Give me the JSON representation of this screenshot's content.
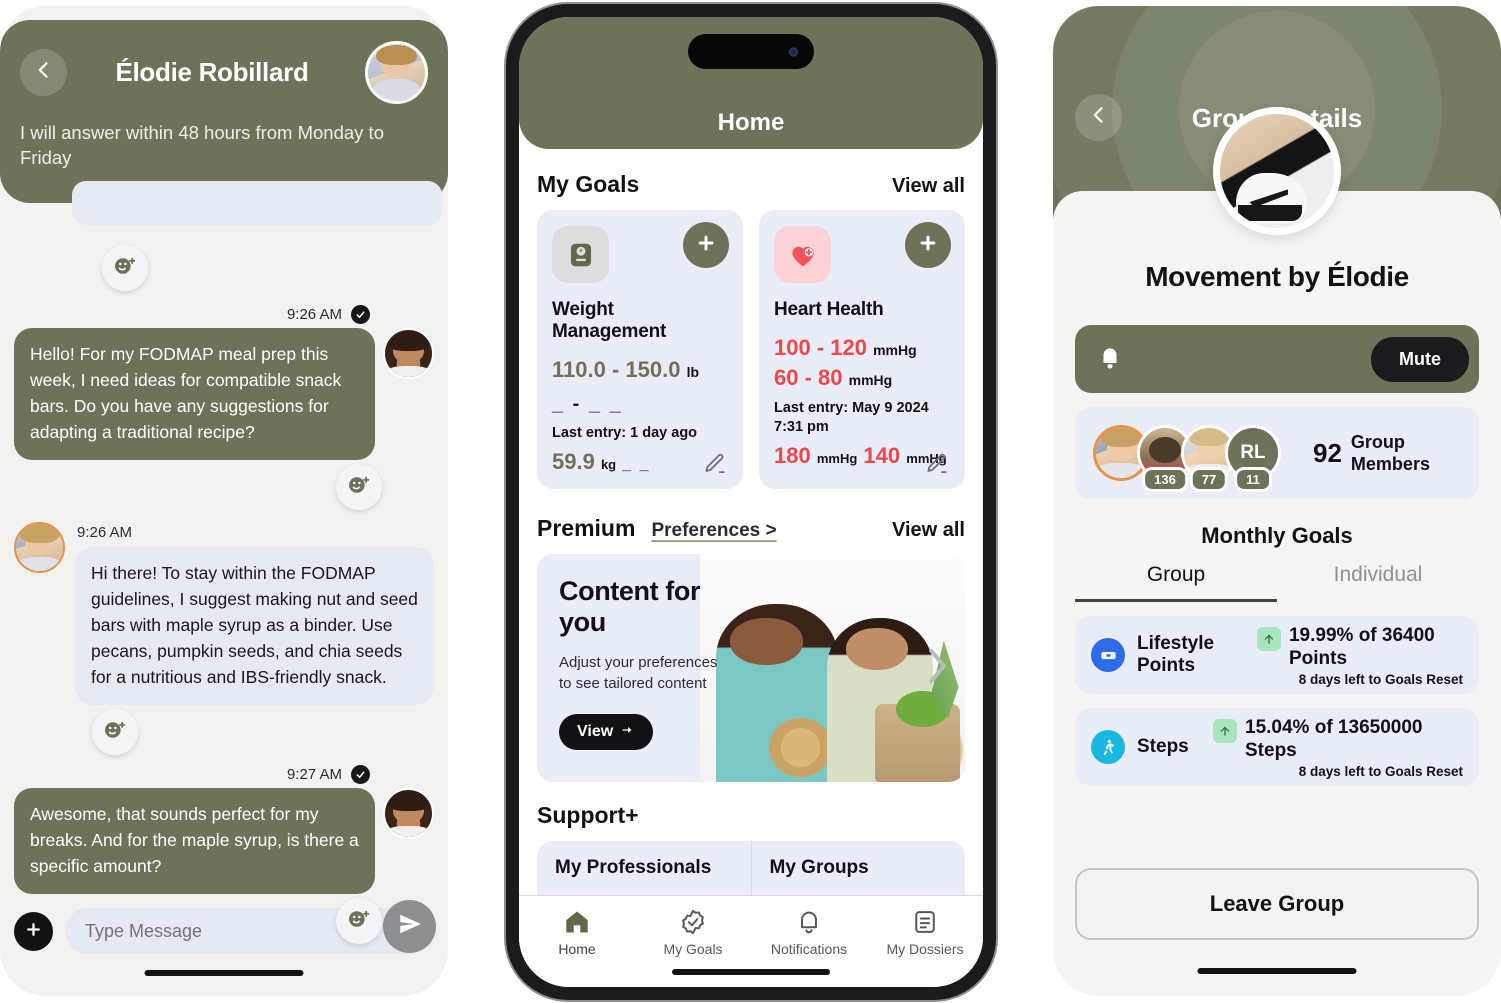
{
  "chat_screen": {
    "header": {
      "back_icon": "chevron-left-icon",
      "contact_name": "Élodie Robillard",
      "avatar": "contact-avatar",
      "availability_note": "I will answer within 48 hours from Monday to Friday"
    },
    "messages": [
      {
        "side": "outgoing",
        "time": "9:26 AM",
        "status_icon": "check-circle-icon",
        "text": "Hello! For my FODMAP meal prep this week, I need ideas for compatible snack bars. Do you have any suggestions for adapting a traditional recipe?"
      },
      {
        "side": "incoming",
        "time": "9:26 AM",
        "text": "Hi there! To stay within the FODMAP guidelines, I suggest making nut and seed bars with maple syrup as a binder. Use pecans, pumpkin seeds, and chia seeds for a nutritious and IBS-friendly snack."
      },
      {
        "side": "outgoing",
        "time": "9:27 AM",
        "status_icon": "check-circle-icon",
        "text": "Awesome, that sounds perfect for my breaks. And for the maple syrup, is there a specific amount?"
      }
    ],
    "reaction_icon": "add-reaction-icon",
    "composer": {
      "add_icon": "plus-icon",
      "placeholder": "Type Message",
      "value": "",
      "send_icon": "send-icon"
    }
  },
  "home_screen": {
    "title": "Home",
    "my_goals": {
      "section_title": "My Goals",
      "view_all": "View all",
      "cards": [
        {
          "icon": "clipboard-scale-icon",
          "add_icon": "plus-icon",
          "name": "Weight Management",
          "target_value": "110.0 - 150.0",
          "target_unit": "lb",
          "placeholder_dashes": "_ - _ _",
          "last_entry": "Last entry: 1 day ago",
          "current_value": "59.9",
          "current_unit": "kg",
          "current_dashes": "_ _",
          "edit_icon": "pencil-icon",
          "accent": "#6b7459"
        },
        {
          "icon": "heart-plus-icon",
          "add_icon": "plus-icon",
          "name": "Heart Health",
          "target_value": "100 - 120",
          "target_unit": "mmHg",
          "target_value2": "60 - 80",
          "target_unit2": "mmHg",
          "last_entry": "Last entry: May 9 2024 7:31 pm",
          "current_value": "180",
          "current_unit": "mmHg",
          "current_value2": "140",
          "current_unit2": "mmHg",
          "edit_icon": "pencil-icon",
          "accent": "#f0474c"
        }
      ]
    },
    "premium": {
      "section_title": "Premium",
      "preferences_link": "Preferences >",
      "view_all": "View all",
      "promo": {
        "heading": "Content for you",
        "body": "Adjust your preferences to see tailored content",
        "button": "View",
        "button_icon": "arrow-right-icon",
        "next_icon": "chevron-right-icon"
      }
    },
    "support": {
      "section_title": "Support+",
      "tiles": [
        {
          "title": "My Professionals"
        },
        {
          "title": "My Groups"
        }
      ]
    },
    "tabbar": [
      {
        "icon": "home-icon",
        "label": "Home",
        "active": true
      },
      {
        "icon": "badge-check-icon",
        "label": "My Goals",
        "active": false
      },
      {
        "icon": "bell-icon",
        "label": "Notifications",
        "active": false
      },
      {
        "icon": "document-list-icon",
        "label": "My Dossiers",
        "active": false
      }
    ]
  },
  "group_screen": {
    "header": {
      "back_icon": "chevron-left-icon",
      "title": "Group Details",
      "avatar": "group-avatar-shoe"
    },
    "group_name": "Movement by Élodie",
    "mute_bar": {
      "bell_icon": "bell-icon",
      "mute_label": "Mute"
    },
    "members": {
      "avatars": [
        {
          "type": "photo",
          "badge": ""
        },
        {
          "type": "photo",
          "badge": "136"
        },
        {
          "type": "photo",
          "badge": "77"
        },
        {
          "type": "initials",
          "initials": "RL",
          "badge": "11"
        }
      ],
      "count": "92",
      "count_label": "Group Members"
    },
    "monthly_goals_title": "Monthly Goals",
    "tabs": [
      {
        "label": "Group",
        "active": true
      },
      {
        "label": "Individual",
        "active": false
      }
    ],
    "goal_rows": [
      {
        "icon": "ticket-icon",
        "icon_color": "#2f6ae8",
        "name": "Lifestyle Points",
        "trend_icon": "arrow-up-icon",
        "stat": "19.99% of 36400 Points",
        "sub": "8 days left to Goals Reset"
      },
      {
        "icon": "walking-icon",
        "icon_color": "#1ab8e0",
        "name": "Steps",
        "trend_icon": "arrow-up-icon",
        "stat": "15.04% of 13650000 Steps",
        "sub": "8 days left to Goals Reset"
      }
    ],
    "leave_button": "Leave Group"
  },
  "theme": {
    "green": "#6b7459",
    "card_blue": "#e9edf8",
    "bubble_in": "#e6eaf3",
    "red": "#f0474c",
    "dark": "#111215"
  }
}
